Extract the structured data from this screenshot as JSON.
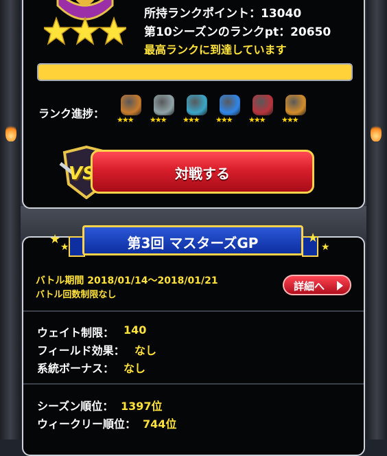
{
  "rank": {
    "points_label": "所持ランクポイント：13040",
    "season_label": "第10シーズンのランクpt：20650",
    "status": "最高ランクに到達しています",
    "progress_fraction": 1.0
  },
  "rank_progress": {
    "label": "ランク進捗：",
    "icons": [
      {
        "name": "rank-bronze-slime-icon",
        "color": "#c97b2b"
      },
      {
        "name": "rank-silver-knight-icon",
        "color": "#8fa3a8"
      },
      {
        "name": "rank-gold-slime-icon",
        "color": "#3aa6c8"
      },
      {
        "name": "rank-blue-slime-icon",
        "color": "#2f86ea"
      },
      {
        "name": "rank-master-icon",
        "color": "#b8333c"
      },
      {
        "name": "rank-legend-icon",
        "color": "#d48d2a"
      }
    ],
    "stars": "★★★"
  },
  "battle_button": {
    "label": "対戦する",
    "vs": "VS"
  },
  "event": {
    "title": "第3回 マスターズGP",
    "period": "バトル期間 2018/01/14～2018/01/21",
    "limit": "バトル回数制限なし",
    "detail_label": "詳細へ",
    "weight_label": "ウェイト制限：",
    "weight_value": "140",
    "field_label": "フィールド効果：",
    "field_value": "なし",
    "bonus_label": "系統ボーナス：",
    "bonus_value": "なし",
    "season_rank_label": "シーズン順位：",
    "season_rank_value": "1397位",
    "weekly_rank_label": "ウィークリー順位：",
    "weekly_rank_value": "744位"
  },
  "colors": {
    "accent_yellow": "#ffe23a",
    "button_red": "#d81e2b",
    "banner_blue": "#0d2fa0"
  }
}
